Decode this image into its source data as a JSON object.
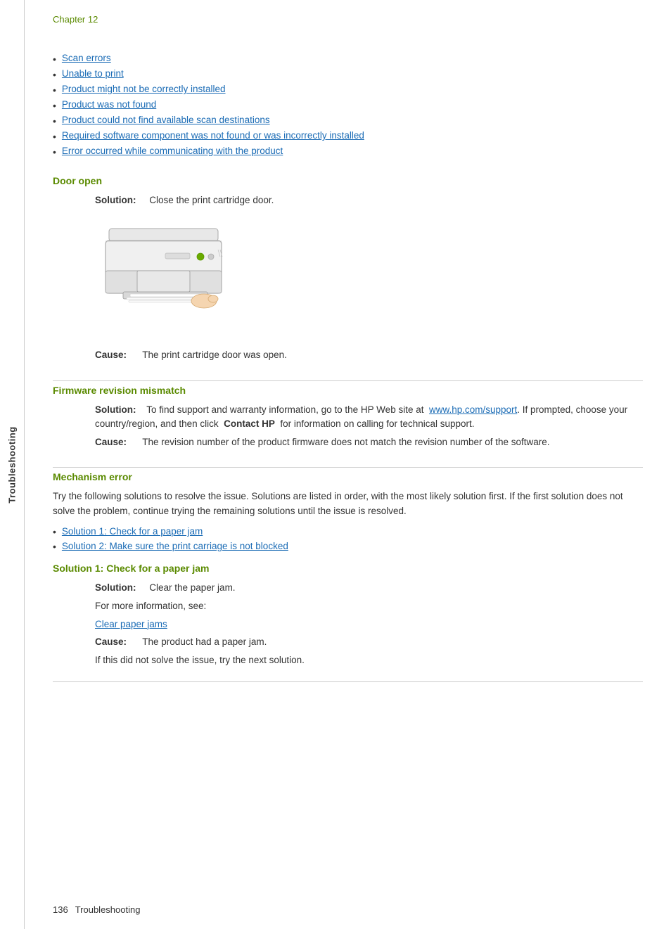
{
  "chapter": "Chapter 12",
  "sidebar_label": "Troubleshooting",
  "nav_links": [
    {
      "text": "Scan errors",
      "href": "#"
    },
    {
      "text": "Unable to print",
      "href": "#"
    },
    {
      "text": "Product might not be correctly installed",
      "href": "#"
    },
    {
      "text": "Product was not found",
      "href": "#"
    },
    {
      "text": "Product could not find available scan destinations",
      "href": "#"
    },
    {
      "text": "Required software component was not found or was incorrectly installed",
      "href": "#"
    },
    {
      "text": "Error occurred while communicating with the product",
      "href": "#"
    }
  ],
  "sections": {
    "door_open": {
      "heading": "Door open",
      "solution_label": "Solution:",
      "solution_text": "Close the print cartridge door.",
      "cause_label": "Cause:",
      "cause_text": "The print cartridge door was open."
    },
    "firmware_mismatch": {
      "heading": "Firmware revision mismatch",
      "solution_label": "Solution:",
      "solution_text_prefix": "To find support and warranty information, go to the HP Web site at",
      "solution_link": "www.hp.com/support",
      "solution_text_suffix": ". If prompted, choose your country/region, and then click",
      "solution_bold_part": "Contact HP",
      "solution_text_end": "for information on calling for technical support.",
      "cause_label": "Cause:",
      "cause_text": "The revision number of the product firmware does not match the revision number of the software."
    },
    "mechanism_error": {
      "heading": "Mechanism error",
      "body_text": "Try the following solutions to resolve the issue. Solutions are listed in order, with the most likely solution first. If the first solution does not solve the problem, continue trying the remaining solutions until the issue is resolved.",
      "sub_links": [
        {
          "text": "Solution 1: Check for a paper jam",
          "href": "#"
        },
        {
          "text": "Solution 2: Make sure the print carriage is not blocked",
          "href": "#"
        }
      ]
    },
    "solution1": {
      "heading": "Solution 1: Check for a paper jam",
      "solution_label": "Solution:",
      "solution_text": "Clear the paper jam.",
      "for_more_text": "For more information, see:",
      "link_text": "Clear paper jams",
      "cause_label": "Cause:",
      "cause_text": "The product had a paper jam.",
      "if_text": "If this did not solve the issue, try the next solution."
    }
  },
  "footer": {
    "page_number": "136",
    "section_label": "Troubleshooting"
  }
}
